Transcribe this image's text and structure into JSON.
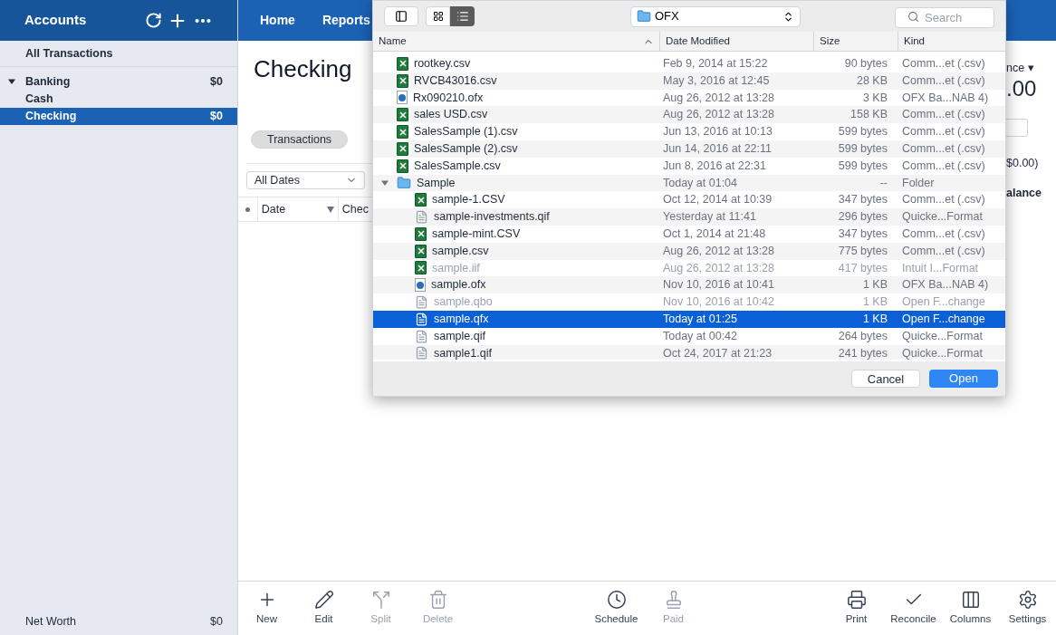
{
  "sidebar": {
    "title": "Accounts",
    "all_transactions": "All Transactions",
    "groups": [
      {
        "name": "Banking",
        "amount": "$0",
        "expanded": true,
        "accounts": [
          {
            "name": "Cash",
            "selected": false
          },
          {
            "name": "Checking",
            "amount": "$0",
            "selected": true
          }
        ]
      }
    ],
    "net_worth": {
      "label": "Net Worth",
      "amount": "$0"
    }
  },
  "nav_tabs": [
    {
      "label": "Home"
    },
    {
      "label": "Reports"
    }
  ],
  "account": {
    "title": "Checking",
    "view_button": "Transactions",
    "date_filter": "All Dates",
    "columns": [
      {
        "label": "Date",
        "sorted": true
      },
      {
        "label": "Chec",
        "sorted": false
      }
    ],
    "balance_label": "nce ▾",
    "balance_value": ".00",
    "balance_sub": "$0.00)",
    "balance_column": "alance"
  },
  "dialog": {
    "folder": "OFX",
    "search_placeholder": "Search",
    "columns": [
      {
        "label": "Name",
        "sorted": true
      },
      {
        "label": "Date Modified",
        "sorted": false
      },
      {
        "label": "Size",
        "sorted": false
      },
      {
        "label": "Kind",
        "sorted": false
      }
    ],
    "files": [
      {
        "name": "rootkey.csv",
        "kind": "excel",
        "date": "Feb 9, 2014 at 15:22",
        "size": "90 bytes",
        "type": "Comm...et (.csv)",
        "disabled": false,
        "selected": false
      },
      {
        "name": "RVCB43016.csv",
        "kind": "excel",
        "date": "May 3, 2016 at 12:45",
        "size": "28 KB",
        "type": "Comm...et (.csv)",
        "disabled": false,
        "selected": false
      },
      {
        "name": "Rx090210.ofx",
        "kind": "ofx",
        "date": "Aug 26, 2012 at 13:28",
        "size": "3 KB",
        "type": "OFX Ba...NAB 4)",
        "disabled": false,
        "selected": false
      },
      {
        "name": "sales USD.csv",
        "kind": "excel",
        "date": "Aug 26, 2012 at 13:28",
        "size": "158 KB",
        "type": "Comm...et (.csv)",
        "disabled": false,
        "selected": false
      },
      {
        "name": "SalesSample (1).csv",
        "kind": "excel",
        "date": "Jun 13, 2016 at 10:13",
        "size": "599 bytes",
        "type": "Comm...et (.csv)",
        "disabled": false,
        "selected": false
      },
      {
        "name": "SalesSample (2).csv",
        "kind": "excel",
        "date": "Jun 14, 2016 at 22:11",
        "size": "599 bytes",
        "type": "Comm...et (.csv)",
        "disabled": false,
        "selected": false
      },
      {
        "name": "SalesSample.csv",
        "kind": "excel",
        "date": "Jun 8, 2016 at 22:31",
        "size": "599 bytes",
        "type": "Comm...et (.csv)",
        "disabled": false,
        "selected": false
      },
      {
        "name": "Sample",
        "kind": "folder",
        "date": "Today at 01:04",
        "size": "--",
        "type": "Folder",
        "disabled": false,
        "selected": false,
        "expanded": true,
        "children": [
          {
            "name": "sample-1.CSV",
            "kind": "excel",
            "date": "Oct 12, 2014 at 10:39",
            "size": "347 bytes",
            "type": "Comm...et (.csv)",
            "disabled": false,
            "selected": false
          },
          {
            "name": "sample-investments.qif",
            "kind": "doc",
            "date": "Yesterday at 11:41",
            "size": "296 bytes",
            "type": "Quicke...Format",
            "disabled": false,
            "selected": false
          },
          {
            "name": "sample-mint.CSV",
            "kind": "excel",
            "date": "Oct 1, 2014 at 21:48",
            "size": "347 bytes",
            "type": "Comm...et (.csv)",
            "disabled": false,
            "selected": false
          },
          {
            "name": "sample.csv",
            "kind": "excel",
            "date": "Aug 26, 2012 at 13:28",
            "size": "775 bytes",
            "type": "Comm...et (.csv)",
            "disabled": false,
            "selected": false
          },
          {
            "name": "sample.iif",
            "kind": "excel",
            "date": "Aug 26, 2012 at 13:28",
            "size": "417 bytes",
            "type": "Intuit I...Format",
            "disabled": true,
            "selected": false
          },
          {
            "name": "sample.ofx",
            "kind": "ofx",
            "date": "Nov 10, 2016 at 10:41",
            "size": "1 KB",
            "type": "OFX Ba...NAB 4)",
            "disabled": false,
            "selected": false
          },
          {
            "name": "sample.qbo",
            "kind": "doc",
            "date": "Nov 10, 2016 at 10:42",
            "size": "1 KB",
            "type": "Open F...change",
            "disabled": true,
            "selected": false
          },
          {
            "name": "sample.qfx",
            "kind": "doc",
            "date": "Today at 01:25",
            "size": "1 KB",
            "type": "Open F...change",
            "disabled": false,
            "selected": true
          },
          {
            "name": "sample.qif",
            "kind": "doc",
            "date": "Today at 00:42",
            "size": "264 bytes",
            "type": "Quicke...Format",
            "disabled": false,
            "selected": false
          },
          {
            "name": "sample1.qif",
            "kind": "doc",
            "date": "Oct 24, 2017 at 21:23",
            "size": "241 bytes",
            "type": "Quicke...Format",
            "disabled": false,
            "selected": false
          }
        ]
      }
    ],
    "buttons": [
      {
        "label": "Cancel",
        "primary": false
      },
      {
        "label": "Open",
        "primary": true
      }
    ]
  },
  "toolbar": [
    {
      "label": "New",
      "disabled": false
    },
    {
      "label": "Edit",
      "disabled": false
    },
    {
      "label": "Split",
      "disabled": true
    },
    {
      "label": "Delete",
      "disabled": true
    },
    {
      "label": "Schedule",
      "disabled": false
    },
    {
      "label": "Paid",
      "disabled": true
    },
    {
      "label": "Print",
      "disabled": false
    },
    {
      "label": "Reconcile",
      "disabled": false
    },
    {
      "label": "Columns",
      "disabled": false
    },
    {
      "label": "Settings",
      "disabled": false
    }
  ]
}
